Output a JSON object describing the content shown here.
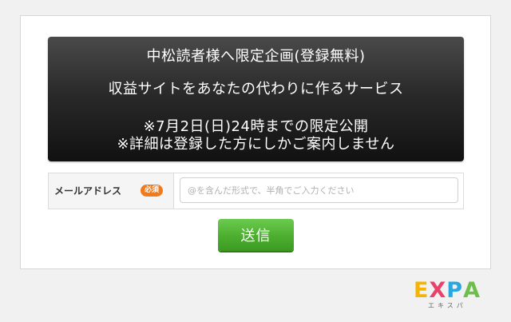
{
  "banner": {
    "line1": "中松読者様へ限定企画(登録無料)",
    "line2": "収益サイトをあなたの代わりに作るサービス",
    "line3": "※7月2日(日)24時までの限定公開",
    "line4": "※詳細は登録した方にしかご案内しません"
  },
  "form": {
    "email_label": "メールアドレス",
    "required_badge": "必須",
    "email_value": "",
    "email_placeholder": "@を含んだ形式で、半角でご入力ください",
    "submit_label": "送信"
  },
  "logo": {
    "letters": [
      "E",
      "X",
      "P",
      "A"
    ],
    "letter_colors": [
      "#f5b400",
      "#e8426a",
      "#2aa7de",
      "#6cc04a"
    ],
    "subtitle": "エキスパ"
  },
  "colors": {
    "badge": "#f27a1a",
    "button": "#4cae2f"
  }
}
